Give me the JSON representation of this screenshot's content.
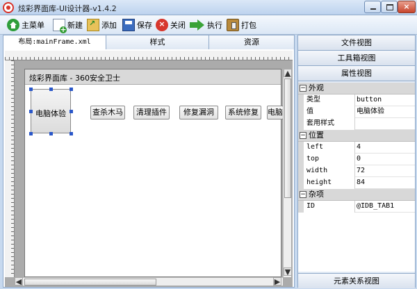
{
  "window": {
    "title": "炫彩界面库-UI设计器-v1.4.2",
    "close_glyph": "×"
  },
  "toolbar": {
    "items": [
      {
        "label": "主菜单",
        "icon": "home-icon"
      },
      {
        "label": "新建",
        "icon": "new-file-icon"
      },
      {
        "label": "添加",
        "icon": "add-folder-icon"
      },
      {
        "label": "保存",
        "icon": "floppy-disk-icon"
      },
      {
        "label": "关闭",
        "icon": "close-circle-icon"
      },
      {
        "label": "执行",
        "icon": "arrow-right-icon"
      },
      {
        "label": "打包",
        "icon": "package-icon"
      }
    ]
  },
  "editor": {
    "tabs": [
      "布局:mainFrame.xml",
      "样式",
      "资源"
    ],
    "active_tab": 0,
    "design_window": {
      "title": "炫彩界面库 - 360安全卫士",
      "selected_button": "电脑体验",
      "buttons": [
        "查杀木马",
        "清理插件",
        "修复漏洞",
        "系统修复",
        "电脑"
      ]
    },
    "scroll_arrows": {
      "up": "▲",
      "down": "▼",
      "left": "◀",
      "right": "▶"
    }
  },
  "right_panel": {
    "file_view": "文件视图",
    "toolbox_view": "工具箱视图",
    "property_view": "属性视图",
    "element_relation_view": "元素关系视图",
    "collapse_glyph": "−",
    "categories": [
      {
        "name": "外观",
        "rows": [
          {
            "name": "类型",
            "value": "button"
          },
          {
            "name": "值",
            "value": "电脑体验"
          },
          {
            "name": "套用样式",
            "value": ""
          }
        ]
      },
      {
        "name": "位置",
        "rows": [
          {
            "name": "left",
            "value": "4"
          },
          {
            "name": "top",
            "value": "0"
          },
          {
            "name": "width",
            "value": "72"
          },
          {
            "name": "height",
            "value": "84"
          }
        ]
      },
      {
        "name": "杂项",
        "rows": [
          {
            "name": "ID",
            "value": "@IDB_TAB1"
          }
        ]
      }
    ]
  },
  "colors": {
    "accent": "#2a57c9",
    "frame": "#c7d9ef",
    "close_button": "#c8452c"
  }
}
